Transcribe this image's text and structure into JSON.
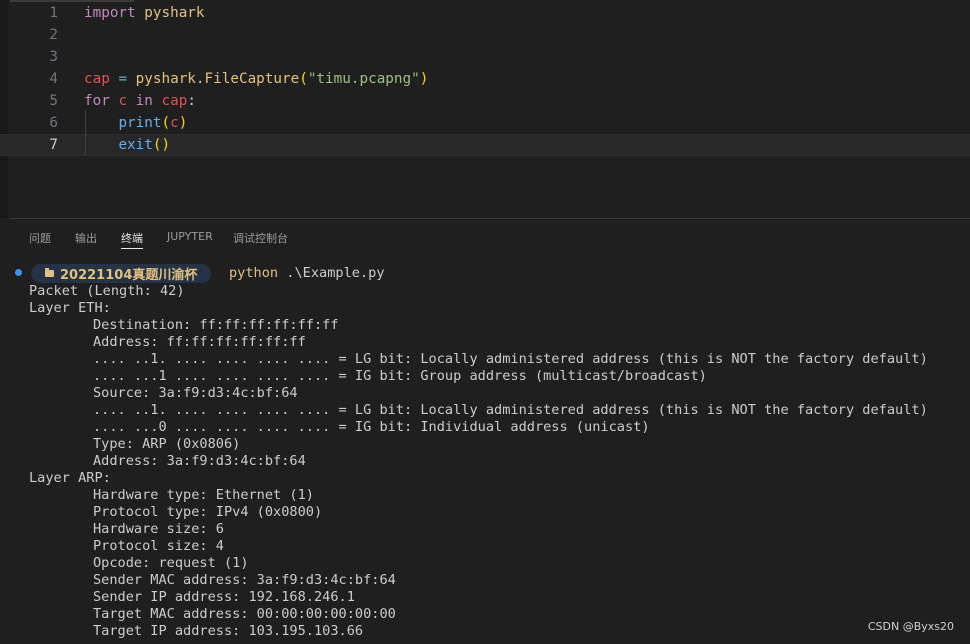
{
  "editor": {
    "lines": [
      {
        "num": "1",
        "tokens": [
          [
            "import",
            "kw"
          ],
          [
            " ",
            "plain"
          ],
          [
            "pyshark",
            "id"
          ]
        ]
      },
      {
        "num": "2",
        "tokens": []
      },
      {
        "num": "3",
        "tokens": []
      },
      {
        "num": "4",
        "tokens": [
          [
            "cap",
            "var"
          ],
          [
            " ",
            "plain"
          ],
          [
            "=",
            "op"
          ],
          [
            " ",
            "plain"
          ],
          [
            "pyshark",
            "id"
          ],
          [
            ".",
            "plain"
          ],
          [
            "FileCapture",
            "id"
          ],
          [
            "(",
            "paren1"
          ],
          [
            "\"timu.pcapng\"",
            "str"
          ],
          [
            ")",
            "paren1"
          ]
        ]
      },
      {
        "num": "5",
        "tokens": [
          [
            "for",
            "kw"
          ],
          [
            " ",
            "plain"
          ],
          [
            "c",
            "var"
          ],
          [
            " ",
            "plain"
          ],
          [
            "in",
            "kw"
          ],
          [
            " ",
            "plain"
          ],
          [
            "cap",
            "var"
          ],
          [
            ":",
            "plain"
          ]
        ]
      },
      {
        "num": "6",
        "tokens": [
          [
            "    ",
            "plain"
          ],
          [
            "print",
            "fn"
          ],
          [
            "(",
            "paren1"
          ],
          [
            "c",
            "var"
          ],
          [
            ")",
            "paren1"
          ]
        ]
      },
      {
        "num": "7",
        "tokens": [
          [
            "    ",
            "plain"
          ],
          [
            "exit",
            "fn"
          ],
          [
            "()",
            "paren1"
          ]
        ],
        "current": true
      }
    ]
  },
  "panel": {
    "tabs": [
      {
        "label": "问题",
        "active": false
      },
      {
        "label": "输出",
        "active": false
      },
      {
        "label": "终端",
        "active": true
      },
      {
        "label": "JUPYTER",
        "active": false
      },
      {
        "label": "调试控制台",
        "active": false
      }
    ]
  },
  "terminal": {
    "prompt_dir": "20221104真题川渝杯",
    "prompt_exe": "python",
    "prompt_arg": " .\\Example.py",
    "output": [
      {
        "text": "Packet (Length: 42)",
        "indent": false
      },
      {
        "text": "Layer ETH:",
        "indent": false
      },
      {
        "text": "Destination: ff:ff:ff:ff:ff:ff",
        "indent": true
      },
      {
        "text": "Address: ff:ff:ff:ff:ff:ff",
        "indent": true
      },
      {
        "text": ".... ..1. .... .... .... .... = LG bit: Locally administered address (this is NOT the factory default)",
        "indent": true
      },
      {
        "text": ".... ...1 .... .... .... .... = IG bit: Group address (multicast/broadcast)",
        "indent": true
      },
      {
        "text": "Source: 3a:f9:d3:4c:bf:64",
        "indent": true
      },
      {
        "text": ".... ..1. .... .... .... .... = LG bit: Locally administered address (this is NOT the factory default)",
        "indent": true
      },
      {
        "text": ".... ...0 .... .... .... .... = IG bit: Individual address (unicast)",
        "indent": true
      },
      {
        "text": "Type: ARP (0x0806)",
        "indent": true
      },
      {
        "text": "Address: 3a:f9:d3:4c:bf:64",
        "indent": true
      },
      {
        "text": "Layer ARP:",
        "indent": false
      },
      {
        "text": "Hardware type: Ethernet (1)",
        "indent": true
      },
      {
        "text": "Protocol type: IPv4 (0x0800)",
        "indent": true
      },
      {
        "text": "Hardware size: 6",
        "indent": true
      },
      {
        "text": "Protocol size: 4",
        "indent": true
      },
      {
        "text": "Opcode: request (1)",
        "indent": true
      },
      {
        "text": "Sender MAC address: 3a:f9:d3:4c:bf:64",
        "indent": true
      },
      {
        "text": "Sender IP address: 192.168.246.1",
        "indent": true
      },
      {
        "text": "Target MAC address: 00:00:00:00:00:00",
        "indent": true
      },
      {
        "text": "Target IP address: 103.195.103.66",
        "indent": true
      }
    ]
  },
  "watermark": "CSDN @Byxs20",
  "icons": {
    "folder": "folder-icon",
    "prompt_status": "status-dot-icon"
  },
  "colors": {
    "accent": "#3794ff",
    "prompt_bg": "#243347",
    "folder": "#e5c07b"
  }
}
